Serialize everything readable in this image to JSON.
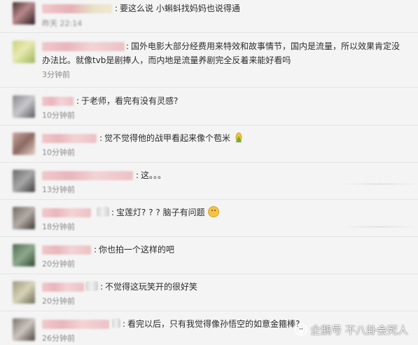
{
  "comments": [
    {
      "text": "要这么说 小蝌蚪找妈妈也说得通",
      "time": "昨天 22:14",
      "time_visible": false,
      "avatar_colors": [
        "#4b2f33",
        "#b98a8c",
        "#2e1d21"
      ]
    },
    {
      "text": "国外电影大部分经费用来特效和故事情节，国内是流量，所以效果肯定没",
      "text2": "办法比。就像tvb是剧捧人，而内地是流量养剧完全反着来能好看吗",
      "time": "3分钟前",
      "time_visible": true,
      "avatar_colors": [
        "#c9d37a",
        "#e8eab0",
        "#9fb55a"
      ]
    },
    {
      "text": "于老师，看完有没有灵感?",
      "time": "10分钟前",
      "time_visible": false,
      "avatar_colors": [
        "#8a8a8e",
        "#c8c8cc",
        "#5a5a60"
      ]
    },
    {
      "text": "觉不觉得他的战甲看起来像个苞米",
      "time": "10分钟前",
      "time_visible": false,
      "avatar_colors": [
        "#caa59a",
        "#8c6a64",
        "#e6cfc6"
      ]
    },
    {
      "text": "这。。。",
      "time": "13分钟前",
      "time_visible": false,
      "avatar_colors": [
        "#6b6b6b",
        "#a7a7a7",
        "#3e3e3e"
      ]
    },
    {
      "text": "宝莲灯? ? ? 脑子有问题",
      "time": "18分钟前",
      "time_visible": false,
      "avatar_colors": [
        "#6f6a66",
        "#b4aba5",
        "#3d3835"
      ]
    },
    {
      "text": "你也拍一个这样的吧",
      "time": "20分钟前",
      "time_visible": false,
      "avatar_colors": [
        "#4f6e52",
        "#8ea88e",
        "#2f4a33"
      ]
    },
    {
      "text": "不觉得这玩笑开的很好笑",
      "time": "20分钟前",
      "time_visible": false,
      "avatar_colors": [
        "#9c9a80",
        "#d6d3b8",
        "#6d6b55"
      ]
    },
    {
      "text": "看完以后，只有我觉得像孙悟空的如意金箍棒?",
      "time": "26分钟前",
      "time_visible": false,
      "avatar_colors": [
        "#7a7470",
        "#cbc4bf",
        "#4a4541"
      ]
    }
  ],
  "watermark": {
    "text": "企鹅号 不八卦会死人"
  }
}
